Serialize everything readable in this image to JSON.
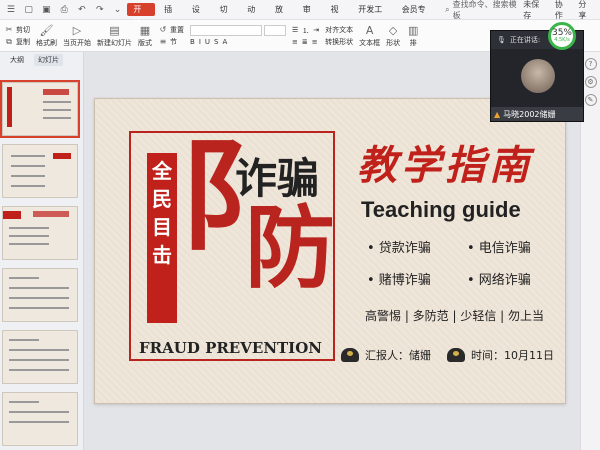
{
  "menubar": {
    "items": [
      "开始",
      "插入",
      "设计",
      "切换",
      "动画",
      "放映",
      "审阅",
      "视图",
      "开发工具",
      "会员专享"
    ],
    "active": "开始",
    "search": "查找命令、搜索模板",
    "save_status": "未保存",
    "collab": "协作",
    "share": "分享"
  },
  "ribbon": {
    "cut": "剪切",
    "copy": "复制",
    "format_painter": "格式刷",
    "play": "当页开始",
    "new_slide": "新建幻灯片",
    "layout": "版式",
    "reset": "重置",
    "section": "节",
    "text_box": "文本框",
    "shape": "形状",
    "start": "排",
    "sort": "对齐文本",
    "convert": "转换形状"
  },
  "left_panel": {
    "tabs": [
      "大纲",
      "幻灯片"
    ],
    "active_tab": "幻灯片"
  },
  "slide": {
    "vertical_text": "全民目击",
    "zhapian": "诈骗",
    "fang": "防",
    "fang_radical": "阝",
    "fraud_prevention": "FRAUD PREVENTION",
    "title_cn": "教学指南",
    "teaching_guide": "Teaching guide",
    "items": [
      "• 贷款诈骗",
      "• 电信诈骗",
      "• 赌博诈骗",
      "• 网络诈骗"
    ],
    "motto": "高警惕 | 多防范 | 少轻信 | 勿上当",
    "reporter": "汇报人：储姗",
    "date": "时间：10月11日"
  },
  "video": {
    "status": "正在讲话:",
    "name": "马晓2002储姗"
  },
  "progress": {
    "percent": "35%",
    "speed": "4.5K/s"
  }
}
